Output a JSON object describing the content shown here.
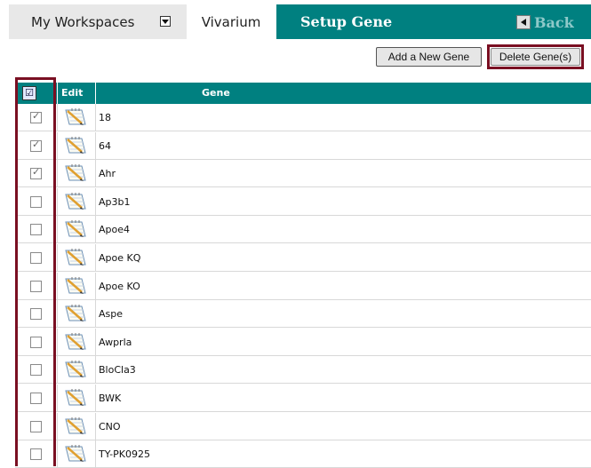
{
  "tabs": {
    "workspaces": "My Workspaces",
    "vivarium": "Vivarium",
    "setup_gene": "Setup Gene",
    "back": "Back"
  },
  "toolbar": {
    "add_label": "Add a New Gene",
    "delete_label": "Delete Gene(s)"
  },
  "table": {
    "columns": {
      "edit": "Edit",
      "gene": "Gene"
    },
    "rows": [
      {
        "name": "18",
        "checked": true
      },
      {
        "name": "64",
        "checked": true
      },
      {
        "name": "Ahr",
        "checked": true
      },
      {
        "name": "Ap3b1",
        "checked": false
      },
      {
        "name": "Apoe4",
        "checked": false
      },
      {
        "name": "Apoe KQ",
        "checked": false
      },
      {
        "name": "Apoe KO",
        "checked": false
      },
      {
        "name": "Aspe",
        "checked": false
      },
      {
        "name": "Awprla",
        "checked": false
      },
      {
        "name": "BloCla3",
        "checked": false
      },
      {
        "name": "BWK",
        "checked": false
      },
      {
        "name": "CNO",
        "checked": false
      },
      {
        "name": "TY-PK0925",
        "checked": false
      }
    ]
  },
  "colors": {
    "header_teal": "#008080",
    "highlight": "#7a0f22"
  },
  "icons": {
    "workspace_dropdown": "chevron-down-icon",
    "back": "back-arrow-icon",
    "select_all": "select-all-checkbox-icon",
    "edit": "edit-notepad-icon"
  }
}
